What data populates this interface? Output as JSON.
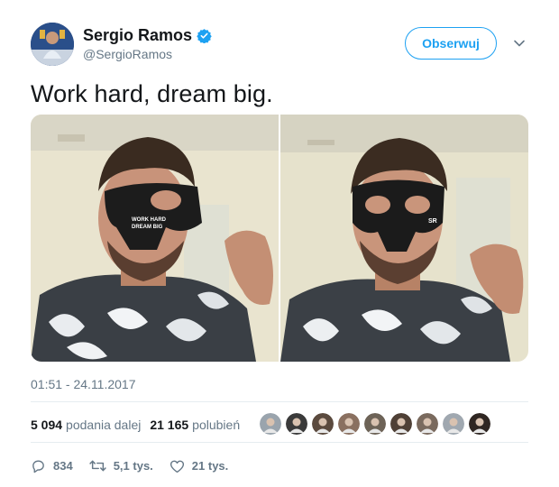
{
  "author": {
    "display_name": "Sergio Ramos",
    "handle": "@SergioRamos",
    "verified": true
  },
  "follow_button_label": "Obserwuj",
  "tweet_text": "Work hard, dream big.",
  "media": {
    "photos": [
      {
        "alt": "photo-1",
        "mask_text": "WORK HARD DREAM BIG"
      },
      {
        "alt": "photo-2",
        "mask_text": "SR"
      }
    ]
  },
  "timestamp": "01:51 - 24.11.2017",
  "stats": {
    "retweets_count": "5 094",
    "retweets_label": "podania dalej",
    "likes_count": "21 165",
    "likes_label": "polubień"
  },
  "likers_count": 9,
  "actions": {
    "replies": "834",
    "retweets": "5,1 tys.",
    "likes": "21 tys."
  },
  "colors": {
    "accent": "#1da1f2",
    "text": "#14171a",
    "muted": "#657786",
    "divider": "#e6ecf0"
  },
  "icons": [
    "verified-badge-icon",
    "chevron-down-icon",
    "reply-icon",
    "retweet-icon",
    "heart-icon"
  ]
}
